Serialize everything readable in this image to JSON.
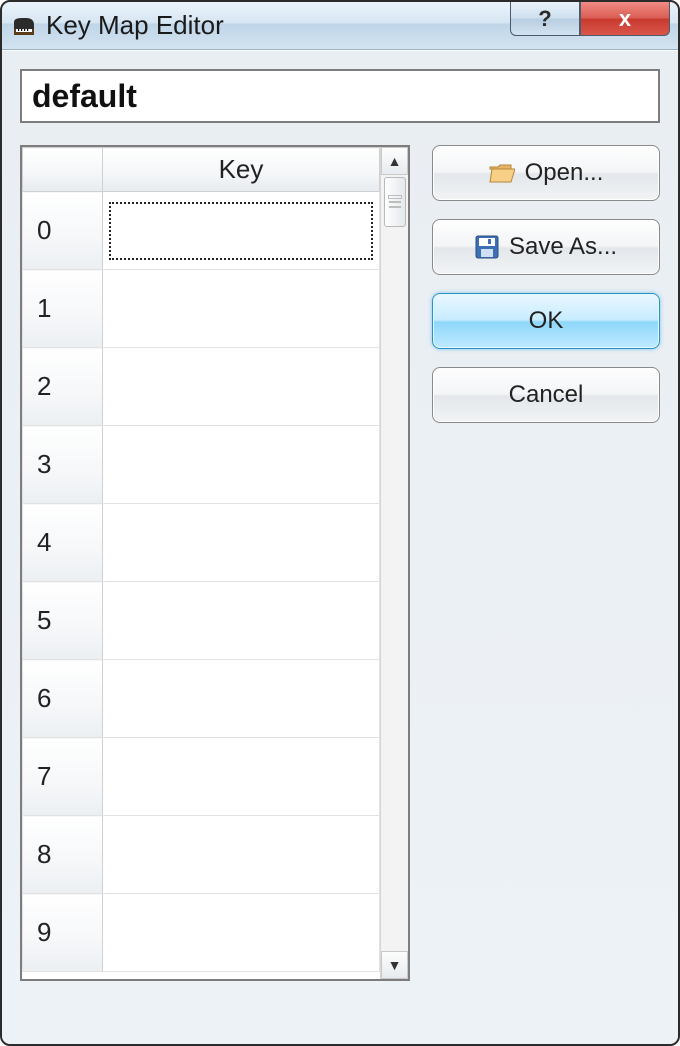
{
  "window": {
    "title": "Key Map Editor"
  },
  "name_field": {
    "value": "default"
  },
  "table": {
    "header": {
      "rownum": "",
      "key": "Key"
    },
    "rows": [
      {
        "index": "0",
        "key": ""
      },
      {
        "index": "1",
        "key": ""
      },
      {
        "index": "2",
        "key": ""
      },
      {
        "index": "3",
        "key": ""
      },
      {
        "index": "4",
        "key": ""
      },
      {
        "index": "5",
        "key": ""
      },
      {
        "index": "6",
        "key": ""
      },
      {
        "index": "7",
        "key": ""
      },
      {
        "index": "8",
        "key": ""
      },
      {
        "index": "9",
        "key": ""
      }
    ],
    "selected_index": 0
  },
  "buttons": {
    "open": "Open...",
    "saveas": "Save As...",
    "ok": "OK",
    "cancel": "Cancel"
  },
  "titlebar_buttons": {
    "help": "?",
    "close": "x"
  }
}
